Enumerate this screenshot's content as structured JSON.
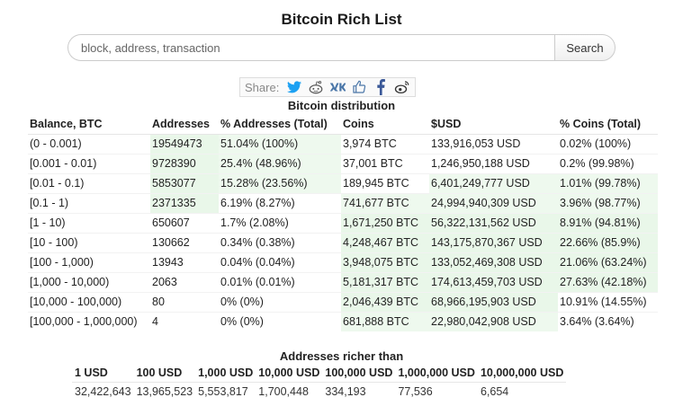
{
  "page": {
    "title": "Bitcoin Rich List"
  },
  "search": {
    "placeholder": "block, address, transaction",
    "button_label": "Search"
  },
  "share": {
    "label": "Share:",
    "icons": [
      "twitter-icon",
      "reddit-icon",
      "vk-icon",
      "like-icon",
      "facebook-icon",
      "weibo-icon"
    ],
    "colors": {
      "twitter": "#1da1f2",
      "reddit": "#ff4500",
      "vk": "#4a76a8",
      "facebook": "#3b5998",
      "weibo": "#333333"
    }
  },
  "distribution": {
    "caption": "Bitcoin distribution",
    "headers": [
      "Balance, BTC",
      "Addresses",
      "% Addresses (Total)",
      "Coins",
      "$USD",
      "% Coins (Total)"
    ],
    "rows": [
      [
        "(0 - 0.001)",
        "19549473",
        "51.04% (100%)",
        "3,974 BTC",
        "133,916,053 USD",
        "0.02% (100%)"
      ],
      [
        "[0.001 - 0.01)",
        "9728390",
        "25.4% (48.96%)",
        "37,001 BTC",
        "1,246,950,188 USD",
        "0.2% (99.98%)"
      ],
      [
        "[0.01 - 0.1)",
        "5853077",
        "15.28% (23.56%)",
        "189,945 BTC",
        "6,401,249,777 USD",
        "1.01% (99.78%)"
      ],
      [
        "[0.1 - 1)",
        "2371335",
        "6.19% (8.27%)",
        "741,677 BTC",
        "24,994,940,309 USD",
        "3.96% (98.77%)"
      ],
      [
        "[1 - 10)",
        "650607",
        "1.7% (2.08%)",
        "1,671,250 BTC",
        "56,322,131,562 USD",
        "8.91% (94.81%)"
      ],
      [
        "[10 - 100)",
        "130662",
        "0.34% (0.38%)",
        "4,248,467 BTC",
        "143,175,870,367 USD",
        "22.66% (85.9%)"
      ],
      [
        "[100 - 1,000)",
        "13943",
        "0.04% (0.04%)",
        "3,948,075 BTC",
        "133,052,469,308 USD",
        "21.06% (63.24%)"
      ],
      [
        "[1,000 - 10,000)",
        "2063",
        "0.01% (0.01%)",
        "5,181,317 BTC",
        "174,613,459,703 USD",
        "27.63% (42.18%)"
      ],
      [
        "[10,000 - 100,000)",
        "80",
        "0% (0%)",
        "2,046,439 BTC",
        "68,966,195,903 USD",
        "10.91% (14.55%)"
      ],
      [
        "[100,000 - 1,000,000)",
        "4",
        "0% (0%)",
        "681,888 BTC",
        "22,980,042,908 USD",
        "3.64% (3.64%)"
      ]
    ]
  },
  "richer_than": {
    "caption": "Addresses richer than",
    "headers": [
      "1 USD",
      "100 USD",
      "1,000 USD",
      "10,000 USD",
      "100,000 USD",
      "1,000,000 USD",
      "10,000,000 USD"
    ],
    "values": [
      "32,422,643",
      "13,965,523",
      "5,553,817",
      "1,700,448",
      "334,193",
      "77,536",
      "6,654"
    ]
  }
}
